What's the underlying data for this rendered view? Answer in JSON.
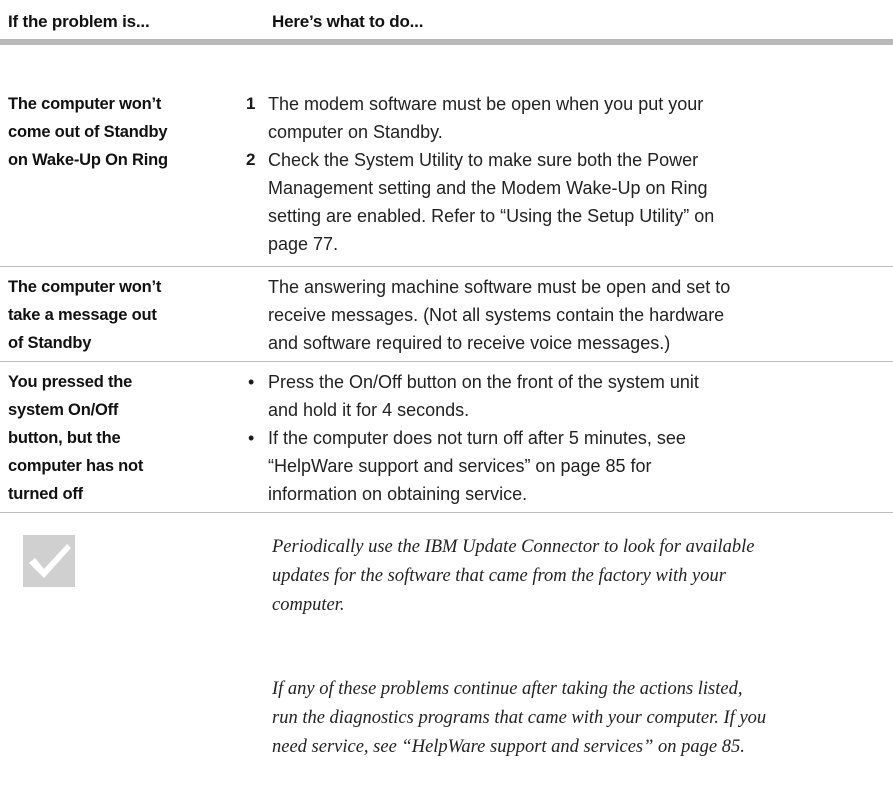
{
  "header": {
    "col_problem": "If the problem is...",
    "col_action": "Here’s what to do..."
  },
  "rows": [
    {
      "problem": [
        "The computer won’t",
        "come out of Standby",
        "on Wake-Up On Ring"
      ],
      "steps": [
        {
          "num": "1",
          "lines": [
            "The modem software must be open when you put your",
            "computer on Standby."
          ]
        },
        {
          "num": "2",
          "lines": [
            "Check the System Utility to make sure both the Power",
            "Management setting and the Modem Wake-Up on Ring",
            "setting are enabled. Refer to “Using the Setup Utility” on",
            "page 77."
          ]
        }
      ]
    },
    {
      "problem": [
        "The computer won’t",
        "take a message out",
        "of Standby"
      ],
      "text": [
        "The answering machine software must be open and set to",
        "receive messages. (Not all systems contain the hardware",
        "and software required to receive voice messages.)"
      ]
    },
    {
      "problem": [
        "You pressed the",
        "system On/Off",
        "button, but the",
        "computer has not",
        "turned off"
      ],
      "bullets": [
        {
          "mark": "•",
          "lines": [
            "Press the On/Off button on the front of the system unit",
            "and hold it for 4 seconds."
          ]
        },
        {
          "mark": "•",
          "lines": [
            "If the computer does not turn off after 5 minutes, see",
            "“HelpWare support and services” on page 85 for",
            "information on obtaining service."
          ]
        }
      ]
    }
  ],
  "notes": {
    "icon": "checkmark-icon",
    "para1": [
      "Periodically use the IBM Update Connector to look for available",
      "updates for the software that came from the factory with your",
      "computer."
    ],
    "para2": [
      "If any of these problems continue after taking the actions listed,",
      "run the diagnostics programs that came with your computer. If you",
      "need service, see “HelpWare support and services” on page 85."
    ]
  }
}
